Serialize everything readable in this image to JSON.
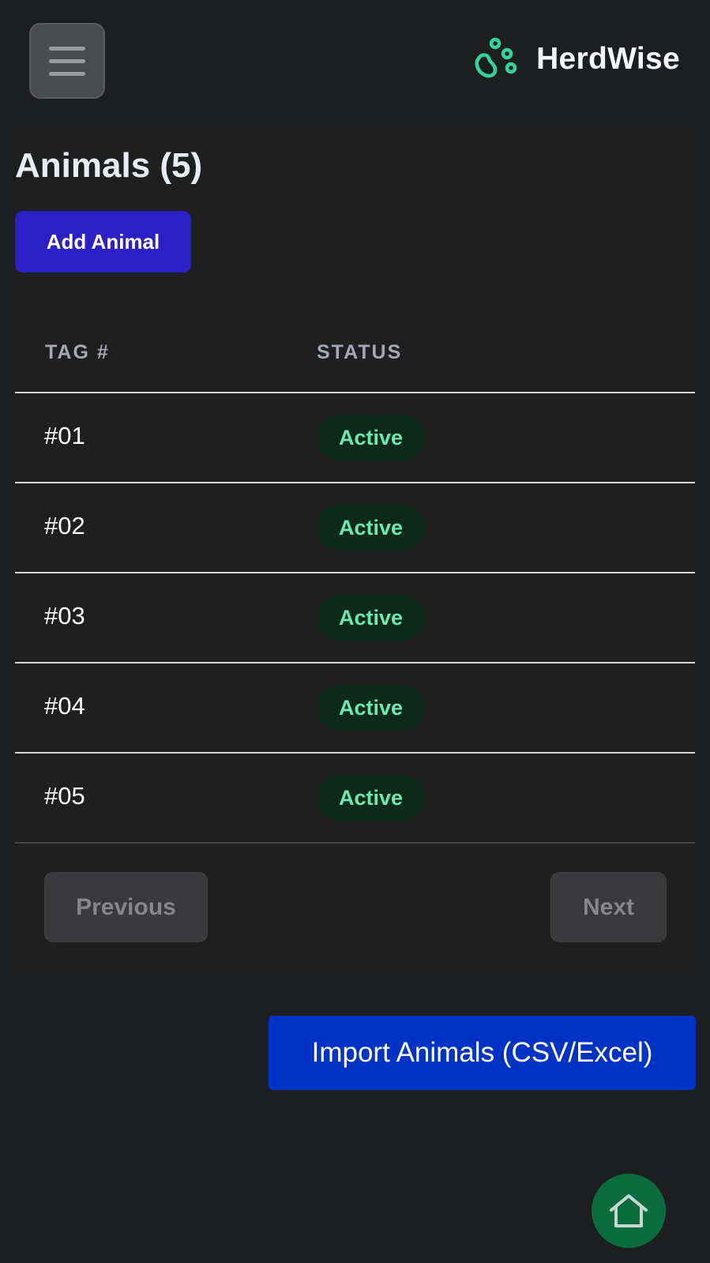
{
  "header": {
    "menu_icon": "hamburger-menu-icon",
    "brand_icon": "paw-icon",
    "brand_name": "HerdWise",
    "brand_color": "#34d399"
  },
  "main": {
    "title": "Animals (5)",
    "add_button_label": "Add Animal",
    "table": {
      "columns": [
        "TAG #",
        "STATUS"
      ],
      "rows": [
        {
          "tag": "#01",
          "status": "Active"
        },
        {
          "tag": "#02",
          "status": "Active"
        },
        {
          "tag": "#03",
          "status": "Active"
        },
        {
          "tag": "#04",
          "status": "Active"
        },
        {
          "tag": "#05",
          "status": "Active"
        }
      ]
    },
    "pagination": {
      "previous_label": "Previous",
      "next_label": "Next"
    },
    "import_button_label": "Import Animals (CSV/Excel)"
  },
  "fab": {
    "icon": "home-icon"
  },
  "colors": {
    "background": "#1d1e20",
    "add_button": "#2b1fc6",
    "import_button": "#0033c5",
    "status_active_bg": "#0b2a1b",
    "status_active_text": "#6ee7b0",
    "home_fab": "#0b6d3d"
  }
}
